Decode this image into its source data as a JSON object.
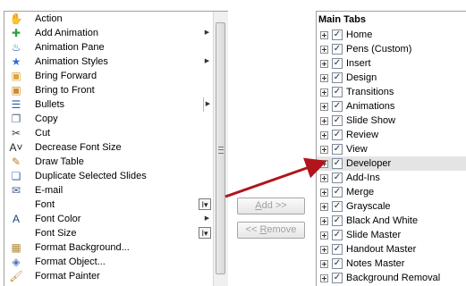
{
  "commands": [
    {
      "label": "Action",
      "icon": "action-icon",
      "glyph": "✋",
      "color": "#c8921a",
      "suffix": ""
    },
    {
      "label": "Add Animation",
      "icon": "add-animation-icon",
      "glyph": "✚",
      "color": "#2e9e3e",
      "suffix": "submenu"
    },
    {
      "label": "Animation Pane",
      "icon": "animation-pane-icon",
      "glyph": "♨",
      "color": "#2a61b5",
      "suffix": ""
    },
    {
      "label": "Animation Styles",
      "icon": "animation-styles-icon",
      "glyph": "★",
      "color": "#2f6fcf",
      "suffix": "submenu"
    },
    {
      "label": "Bring Forward",
      "icon": "bring-forward-icon",
      "glyph": "▣",
      "color": "#d8a540",
      "suffix": ""
    },
    {
      "label": "Bring to Front",
      "icon": "bring-to-front-icon",
      "glyph": "▣",
      "color": "#d08d2a",
      "suffix": ""
    },
    {
      "label": "Bullets",
      "icon": "bullets-icon",
      "glyph": "☰",
      "color": "#2c5ca8",
      "suffix": "submenu-bar"
    },
    {
      "label": "Copy",
      "icon": "copy-icon",
      "glyph": "❐",
      "color": "#5a6b86",
      "suffix": ""
    },
    {
      "label": "Cut",
      "icon": "cut-icon",
      "glyph": "✂",
      "color": "#3a3a3a",
      "suffix": ""
    },
    {
      "label": "Decrease Font Size",
      "icon": "decrease-font-size-icon",
      "glyph": "A˅",
      "color": "#222222",
      "suffix": ""
    },
    {
      "label": "Draw Table",
      "icon": "draw-table-icon",
      "glyph": "✎",
      "color": "#c07a1e",
      "suffix": ""
    },
    {
      "label": "Duplicate Selected Slides",
      "icon": "duplicate-slides-icon",
      "glyph": "❏",
      "color": "#4a6fa5",
      "suffix": ""
    },
    {
      "label": "E-mail",
      "icon": "email-icon",
      "glyph": "✉",
      "color": "#3b5f95",
      "suffix": ""
    },
    {
      "label": "Font",
      "icon": "",
      "glyph": "",
      "color": "#000000",
      "suffix": "spinner"
    },
    {
      "label": "Font Color",
      "icon": "font-color-icon",
      "glyph": "A",
      "color": "#1f3f80",
      "suffix": "submenu"
    },
    {
      "label": "Font Size",
      "icon": "",
      "glyph": "",
      "color": "#000000",
      "suffix": "spinner"
    },
    {
      "label": "Format Background...",
      "icon": "format-background-icon",
      "glyph": "▦",
      "color": "#b08a3a",
      "suffix": ""
    },
    {
      "label": "Format Object...",
      "icon": "format-object-icon",
      "glyph": "◈",
      "color": "#4a78b8",
      "suffix": ""
    },
    {
      "label": "Format Painter",
      "icon": "format-painter-icon",
      "glyph": "🖌",
      "color": "#c09030",
      "suffix": ""
    }
  ],
  "buttons": {
    "add_text": "Add >>",
    "add_accel": "A",
    "add_rest": "dd >>",
    "remove_text": "<< Remove",
    "remove_pre": "<< ",
    "remove_accel": "R",
    "remove_rest": "emove"
  },
  "tabs_header": "Main Tabs",
  "tabs": [
    {
      "label": "Home",
      "checked": true
    },
    {
      "label": "Pens (Custom)",
      "checked": true
    },
    {
      "label": "Insert",
      "checked": true
    },
    {
      "label": "Design",
      "checked": true
    },
    {
      "label": "Transitions",
      "checked": true
    },
    {
      "label": "Animations",
      "checked": true
    },
    {
      "label": "Slide Show",
      "checked": true
    },
    {
      "label": "Review",
      "checked": true
    },
    {
      "label": "View",
      "checked": true
    },
    {
      "label": "Developer",
      "checked": true,
      "selected": true
    },
    {
      "label": "Add-Ins",
      "checked": true
    },
    {
      "label": "Merge",
      "checked": true
    },
    {
      "label": "Grayscale",
      "checked": true
    },
    {
      "label": "Black And White",
      "checked": true
    },
    {
      "label": "Slide Master",
      "checked": true
    },
    {
      "label": "Handout Master",
      "checked": true
    },
    {
      "label": "Notes Master",
      "checked": true
    },
    {
      "label": "Background Removal",
      "checked": true
    }
  ],
  "annotation_color": "#b0141c"
}
